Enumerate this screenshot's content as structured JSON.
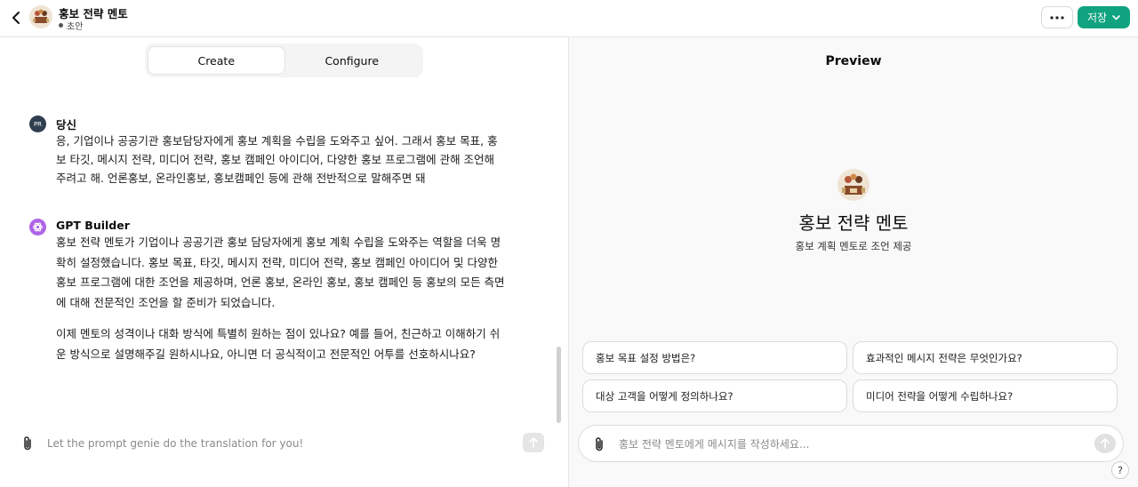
{
  "header": {
    "gpt_name": "홍보 전략 멘토",
    "status": "초안",
    "save_label": "저장",
    "colors": {
      "save_bg": "#10a37f"
    }
  },
  "tabs": [
    {
      "label": "Create",
      "active": true
    },
    {
      "label": "Configure",
      "active": false
    }
  ],
  "chat": {
    "user": {
      "avatar_initials": "PR",
      "name": "당신",
      "lines": [
        "응, 기업이나 공공기관 홍보담당자에게 홍보 계획을 수립을 도와주고 싶어. 그래서 홍보 목표, 홍",
        "보 타깃, 메시지 전략, 미디어 전략, 홍보 캠페인 아이디어, 다양한 홍보 프로그램에 관해 조언해",
        "주려고 해. 언론홍보, 온라인홍보, 홍보캠페인 등에 관해 전반적으로 말해주면 돼"
      ]
    },
    "bot": {
      "name": "GPT Builder",
      "para1": [
        "홍보 전략 멘토가 기업이나 공공기관 홍보 담당자에게 홍보 계획 수립을 도와주는 역할을 더욱 명",
        "확히 설정했습니다. 홍보 목표, 타깃, 메시지 전략, 미디어 전략, 홍보 캠페인 아이디어 및 다양한",
        "홍보 프로그램에 대한 조언을 제공하며, 언론 홍보, 온라인 홍보, 홍보 캠페인 등 홍보의 모든 측면",
        "에 대해 전문적인 조언을 할 준비가 되었습니다."
      ],
      "para2": [
        "이제 멘토의 성격이나 대화 방식에 특별히 원하는 점이 있나요? 예를 들어, 친근하고 이해하기 쉬",
        "운 방식으로 설명해주길 원하시나요, 아니면 더 공식적이고 전문적인 어투를 선호하시나요?"
      ]
    },
    "input_placeholder": "Let the prompt genie do the translation for you!"
  },
  "preview": {
    "title": "Preview",
    "gpt_name": "홍보 전략 멘토",
    "description": "홍보 계획 멘토로 조언 제공",
    "suggestions": [
      "홍보 목표 설정 방법은?",
      "효과적인 메시지 전략은 무엇인가요?",
      "대상 고객을 어떻게 정의하나요?",
      "미디어 전략을 어떻게 수립하나요?"
    ],
    "input_placeholder": "홍보 전략 멘토에게 메시지를 작성하세요...",
    "help_label": "?"
  }
}
